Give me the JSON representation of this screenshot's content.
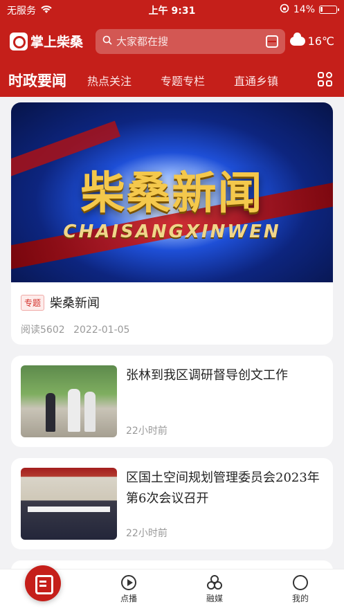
{
  "status_bar": {
    "carrier": "无服务",
    "time": "上午 9:31",
    "battery_percent": "14%",
    "battery_level": 0.14
  },
  "header": {
    "app_name": "掌上柴桑",
    "search_placeholder": "大家都在搜",
    "weather_temp": "16℃",
    "weather_icon": "cloud-icon"
  },
  "tabs": [
    {
      "label": "时政要闻",
      "active": true
    },
    {
      "label": "热点关注"
    },
    {
      "label": "专题专栏"
    },
    {
      "label": "直通乡镇"
    }
  ],
  "feed": {
    "featured": {
      "banner_title": "柴桑新闻",
      "banner_subtitle": "CHAISANGXINWEN",
      "tag": "专题",
      "title": "柴桑新闻",
      "reads": "阅读5602",
      "date": "2022-01-05"
    },
    "items": [
      {
        "title": "张林到我区调研督导创文工作",
        "time": "22小时前"
      },
      {
        "title": "区国土空间规划管理委员会2023年第6次会议召开",
        "time": "22小时前"
      }
    ]
  },
  "bottom_nav": [
    {
      "label": "",
      "icon": "news-icon",
      "active": true
    },
    {
      "label": "点播",
      "icon": "play-icon"
    },
    {
      "label": "融媒",
      "icon": "media-icon"
    },
    {
      "label": "我的",
      "icon": "profile-icon"
    }
  ],
  "colors": {
    "brand_red": "#c51f1a",
    "tag_red": "#d3322c"
  }
}
